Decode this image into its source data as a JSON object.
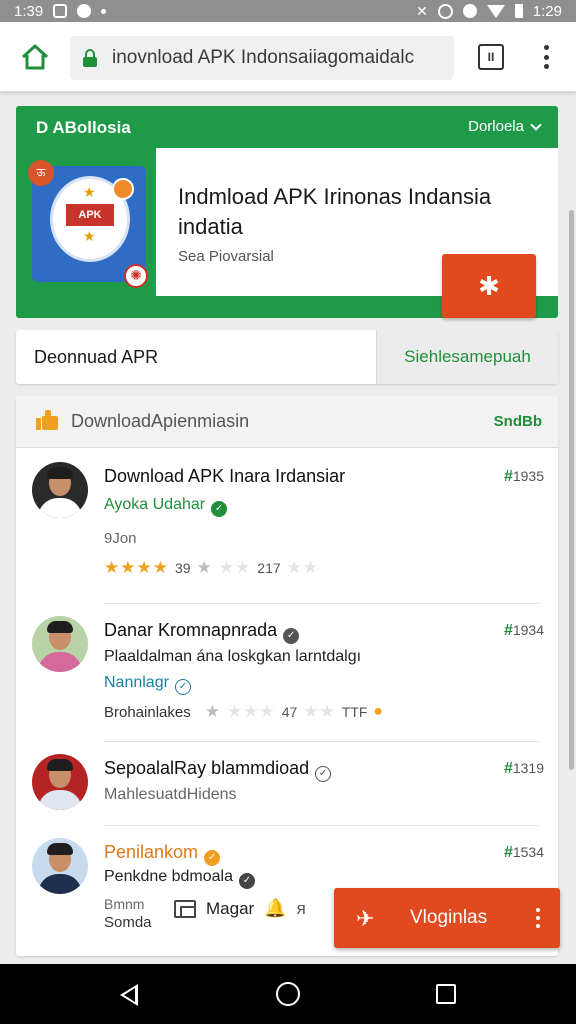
{
  "status_bar": {
    "time_left": "1:39",
    "time_right": "1:29"
  },
  "browser": {
    "url": "inovnload APK Indonsaiiagomaidalc",
    "tabs_count": "II"
  },
  "hero": {
    "brand": "D ABollosia",
    "lang": "Dorloela",
    "title": "Indmload APK Irinonas Indansia indatia",
    "subtitle": "Sea Piovarsial",
    "action_icon": "✱",
    "icon_label": "APK",
    "icon_badge": "ऊ"
  },
  "download_row": {
    "label": "Deonnuad APR",
    "action": "Siehlesamepuah"
  },
  "list": {
    "header_title": "DownloadApienmiasin",
    "header_action": "SndBb",
    "items": [
      {
        "title": "Download APK Inara Irdansiar",
        "subtitle": "Ayoka Udahar",
        "meta": "9Jon",
        "rating_a": "39",
        "rating_b": "217",
        "price": "1935",
        "avatar_bg": "#cfd7e2",
        "shirt": "#ffffff"
      },
      {
        "title": "Danar Kromnapnrada",
        "subtitle": "Plaaldalman ána loskgkan larntdalgı",
        "subtitle2": "Nannlagr",
        "meta": "Brohainlakes",
        "rating_a": "47",
        "rating_b": "TTF",
        "price": "1934",
        "avatar_bg": "#b9d3a8",
        "shirt": "#d36a9a"
      },
      {
        "title": "SepoalalRay blammdioad",
        "subtitle": "MahlesuatdHidens",
        "price": "1319",
        "avatar_bg": "#b52424",
        "shirt": "#dfe6ef"
      },
      {
        "title": "Penilankom",
        "subtitle": "Penkdne bdmoala",
        "meta": "Bmnm",
        "meta2": "Somda",
        "price": "1534",
        "avatar_bg": "#c7dbee",
        "shirt": "#1d2f4d"
      }
    ]
  },
  "bottom_tools": {
    "label": "Magar",
    "bell": "🔔",
    "tool": "ᴙ"
  },
  "float_button": {
    "label": "Vloginlas",
    "icon": "✈"
  },
  "icons": {
    "home": "home-icon",
    "lock": "lock-icon",
    "tabs": "tabs-icon",
    "menu": "more-vert-icon",
    "thumb": "thumbs-up-icon",
    "verified": "verified-icon",
    "star": "star-icon"
  },
  "colors": {
    "brand_green": "#1f9a48",
    "accent_orange": "#e04a1e",
    "star": "#f0a020"
  }
}
